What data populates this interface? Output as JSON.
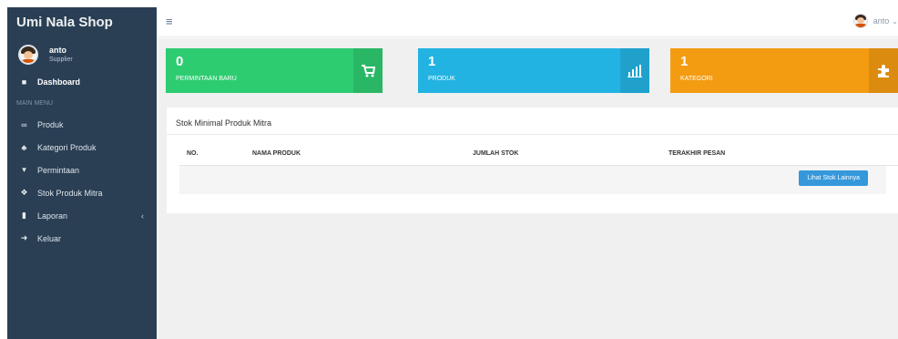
{
  "sidebar": {
    "brand": "Umi Nala Shop",
    "profile": {
      "name": "anto",
      "role": "Supplier"
    },
    "dashboard_label": "Dashboard",
    "menu_header": "MAIN MENU",
    "items": [
      {
        "label": "Produk",
        "icon": "glasses-icon"
      },
      {
        "label": "Kategori Produk",
        "icon": "sitemap-icon"
      },
      {
        "label": "Permintaan",
        "icon": "cart-icon"
      },
      {
        "label": "Stok Produk Mitra",
        "icon": "cubes-icon"
      },
      {
        "label": "Laporan",
        "icon": "file-icon"
      },
      {
        "label": "Keluar",
        "icon": "sign-out-icon"
      }
    ]
  },
  "topbar": {
    "user": "anto"
  },
  "stats": [
    {
      "value": "0",
      "label": "PERMINTAAN BARU",
      "icon": "cart-icon",
      "color": "#2ecc71"
    },
    {
      "value": "1",
      "label": "PRODUK",
      "icon": "bar-chart-icon",
      "color": "#22b3e2"
    },
    {
      "value": "1",
      "label": "KATEGORI",
      "icon": "puzzle-icon",
      "color": "#f39c12"
    }
  ],
  "panel": {
    "title": "Stok Minimal Produk Mitra",
    "columns": [
      "NO.",
      "NAMA PRODUK",
      "JUMLAH STOK",
      "TERAKHIR PESAN"
    ],
    "button_label": "Lihat Stok Lainnya"
  }
}
